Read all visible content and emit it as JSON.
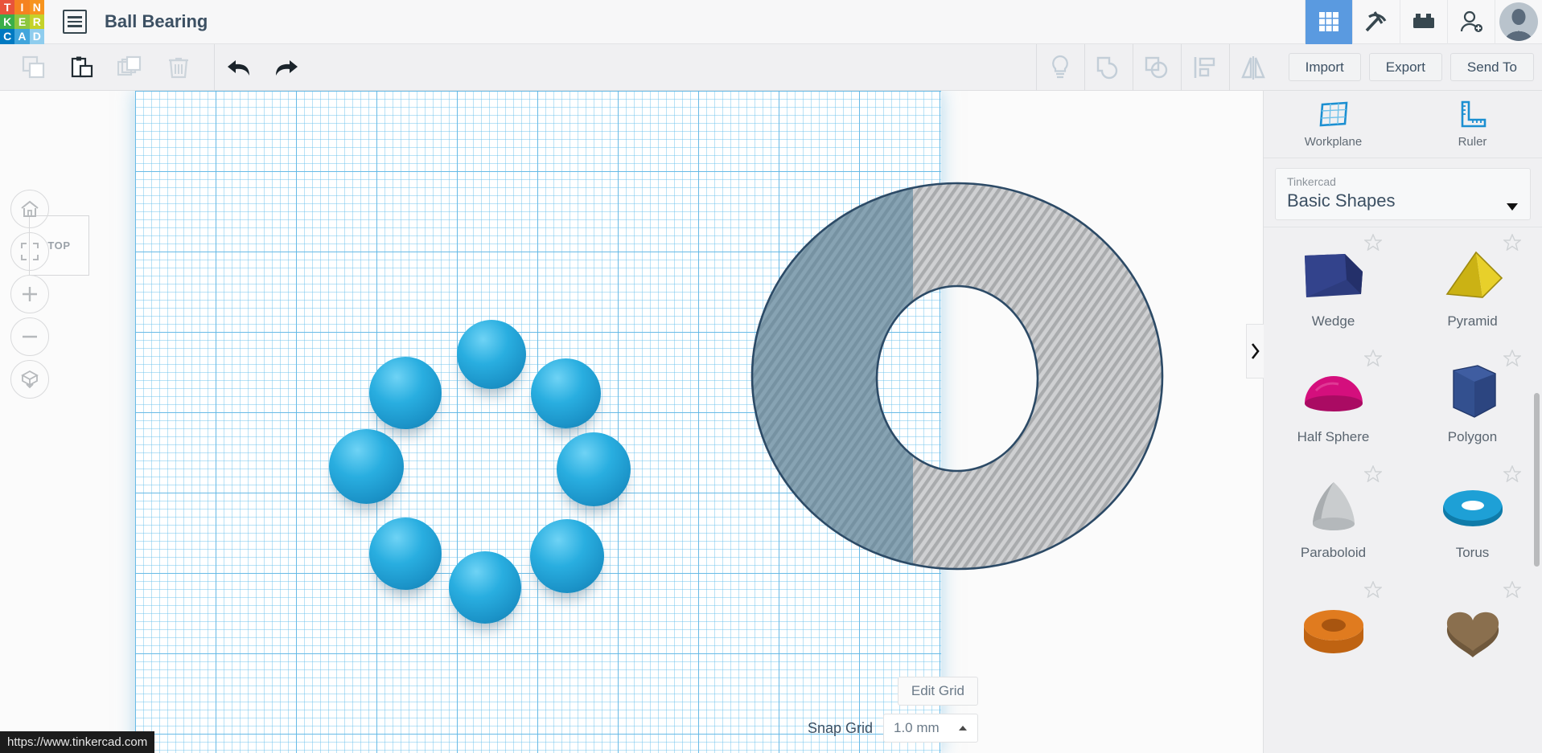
{
  "app": {
    "name": "Tinkercad",
    "logo_letters": [
      "T",
      "I",
      "N",
      "K",
      "E",
      "R",
      "C",
      "A",
      "D"
    ],
    "logo_colors": [
      "#e8533a",
      "#f58220",
      "#f7941e",
      "#3aae49",
      "#8cc63e",
      "#c5d22a",
      "#0079c1",
      "#41a5dc",
      "#8fcdee"
    ],
    "status_url": "https://www.tinkercad.com"
  },
  "header": {
    "project_title": "Ball Bearing",
    "doc_icon": "list-document-icon",
    "right_icons": [
      {
        "name": "gallery-grid-icon",
        "active": true
      },
      {
        "name": "codeblocks-pickaxe-icon",
        "active": false
      },
      {
        "name": "lego-brick-icon",
        "active": false
      },
      {
        "name": "add-user-icon",
        "active": false
      }
    ],
    "avatar": "user-avatar"
  },
  "toolbar": {
    "left_icons": [
      {
        "name": "copy-icon",
        "enabled": false
      },
      {
        "name": "paste-icon",
        "enabled": true
      },
      {
        "name": "duplicate-icon",
        "enabled": false
      },
      {
        "name": "delete-trash-icon",
        "enabled": false
      },
      {
        "name": "undo-icon",
        "enabled": true
      },
      {
        "name": "redo-icon",
        "enabled": true
      }
    ],
    "right_icons": [
      {
        "name": "lightbulb-hint-icon"
      },
      {
        "name": "group-shapes-icon"
      },
      {
        "name": "ungroup-shapes-icon"
      },
      {
        "name": "align-icon"
      },
      {
        "name": "mirror-flip-icon"
      }
    ],
    "import_label": "Import",
    "export_label": "Export",
    "sendto_label": "Send To"
  },
  "canvas": {
    "view_cube_label": "TOP",
    "nav_buttons": [
      {
        "name": "home-view-button"
      },
      {
        "name": "fit-to-view-button"
      },
      {
        "name": "zoom-in-button"
      },
      {
        "name": "zoom-out-button"
      },
      {
        "name": "perspective-toggle-button"
      }
    ],
    "objects": [
      {
        "name": "ring-hole-shape",
        "type": "torus-hole",
        "color": "#9d9fa2"
      },
      {
        "name": "bearing-ball",
        "type": "sphere",
        "color": "#1fa7dc",
        "count": 8
      }
    ]
  },
  "grid_controls": {
    "edit_grid_label": "Edit Grid",
    "snap_grid_label": "Snap Grid",
    "snap_grid_value": "1.0 mm"
  },
  "right_panel": {
    "tools": [
      {
        "label": "Workplane",
        "icon": "workplane-icon"
      },
      {
        "label": "Ruler",
        "icon": "ruler-icon"
      }
    ],
    "library_source": "Tinkercad",
    "library_name": "Basic Shapes",
    "dropdown_icon": "chevron-down-icon",
    "collapse_icon": "chevron-right-icon",
    "shapes": [
      {
        "label": "Wedge",
        "color": "#2d3c7e",
        "art": "wedge"
      },
      {
        "label": "Pyramid",
        "color": "#e0c617",
        "art": "pyramid"
      },
      {
        "label": "Half Sphere",
        "color": "#d40f7d",
        "art": "halfsphere"
      },
      {
        "label": "Polygon",
        "color": "#33508f",
        "art": "polygon"
      },
      {
        "label": "Paraboloid",
        "color": "#b8bcbe",
        "art": "paraboloid"
      },
      {
        "label": "Torus",
        "color": "#1590c4",
        "art": "torus"
      },
      {
        "label": "",
        "color": "#e07b1f",
        "art": "tube"
      },
      {
        "label": "",
        "color": "#8a6f4e",
        "art": "heart"
      }
    ]
  }
}
